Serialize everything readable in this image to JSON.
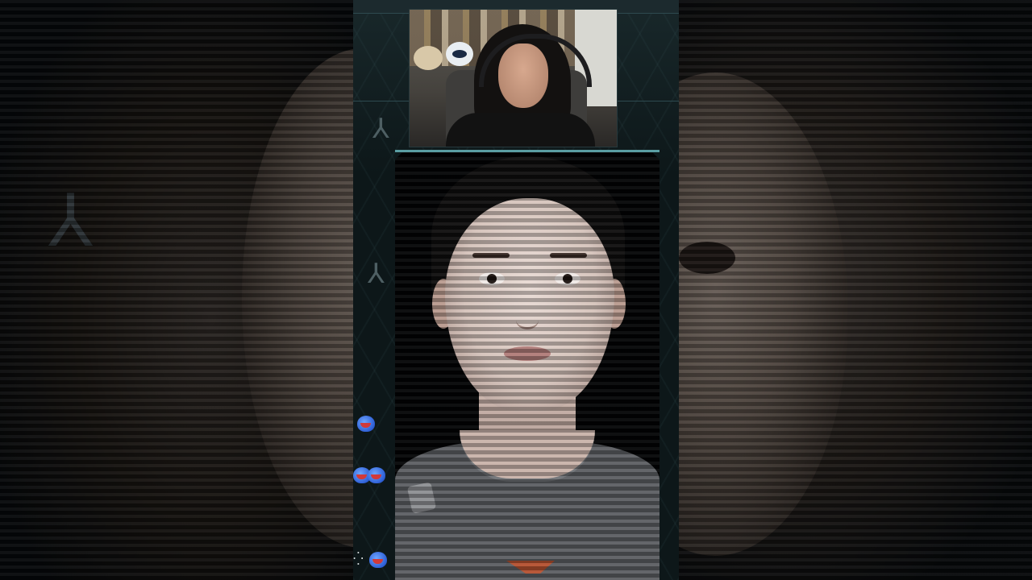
{
  "video": {
    "layout": "vertical-short",
    "frame_accent_color": "#5b9ea3",
    "background_color": "#0d1719"
  },
  "webcam": {
    "icon": "webcam-feed"
  },
  "character": {
    "icon": "character-portrait"
  },
  "chat_overlay": {
    "emotes": [
      "blue-bird-emote",
      "blue-bird-emote",
      "blue-bird-emote",
      "blue-bird-emote"
    ]
  }
}
